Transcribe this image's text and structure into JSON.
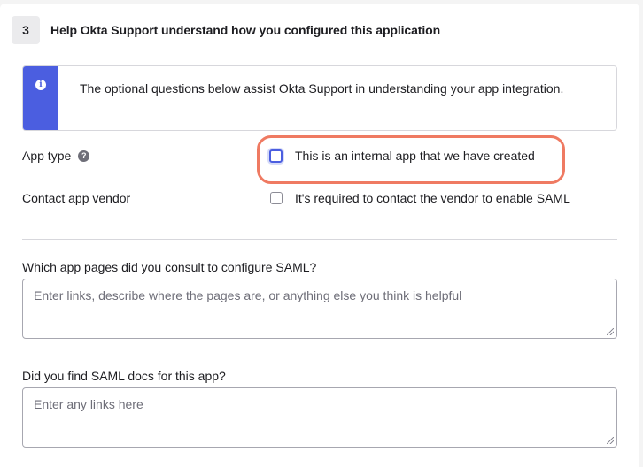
{
  "step": {
    "number": "3",
    "title": "Help Okta Support understand how you configured this application"
  },
  "callout": {
    "icon": "info-icon",
    "text": "The optional questions below assist Okta Support in understanding your app integration."
  },
  "app_type": {
    "label": "App type",
    "help_icon": "question-icon",
    "checkbox_label": "This is an internal app that we have created",
    "checked": false
  },
  "contact_vendor": {
    "label": "Contact app vendor",
    "checkbox_label": "It's required to contact the vendor to enable SAML",
    "checked": false
  },
  "pages_question": {
    "label": "Which app pages did you consult to configure SAML?",
    "placeholder": "Enter links, describe where the pages are, or anything else you think is helpful",
    "value": ""
  },
  "docs_question": {
    "label": "Did you find SAML docs for this app?",
    "placeholder": "Enter any links here",
    "value": ""
  },
  "colors": {
    "accent": "#4b5ee0",
    "highlight": "#ef7a62"
  }
}
